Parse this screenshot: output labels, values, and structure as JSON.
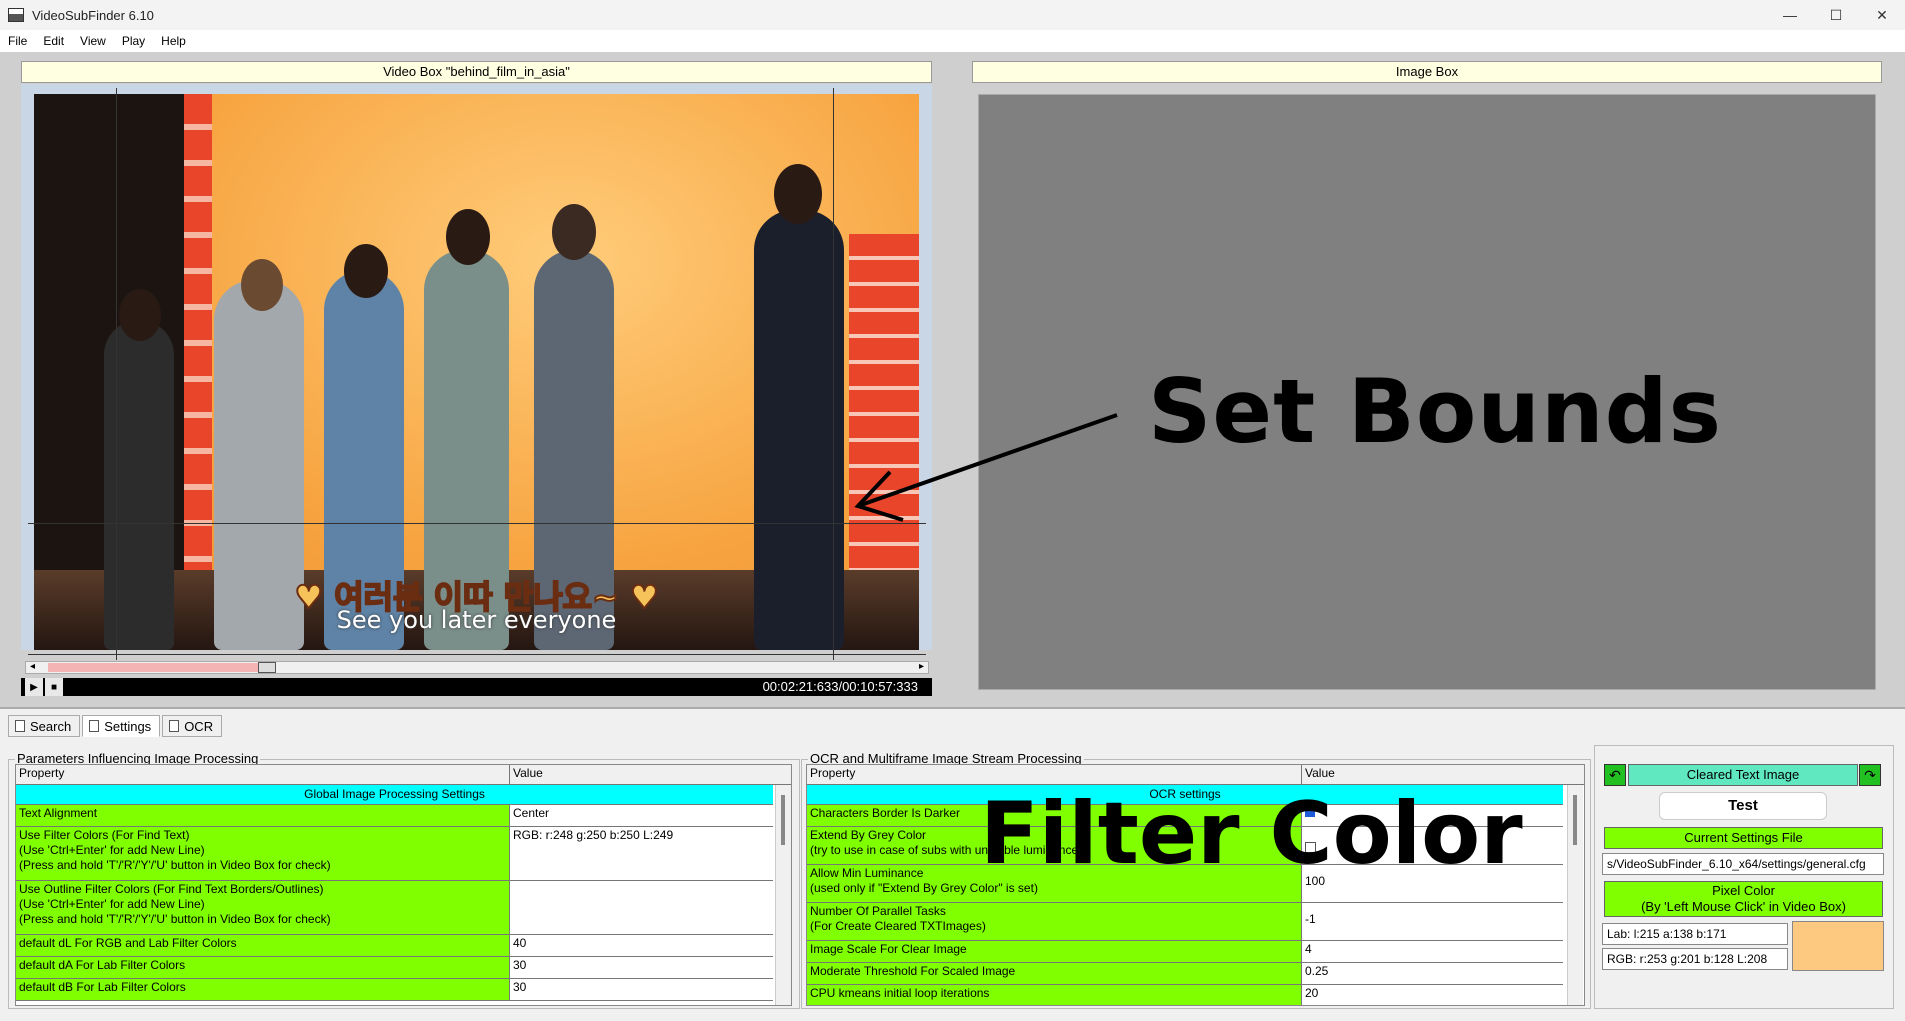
{
  "window": {
    "title": "VideoSubFinder 6.10",
    "controls": [
      "—",
      "☐",
      "✕"
    ]
  },
  "menu": [
    "File",
    "Edit",
    "View",
    "Play",
    "Help"
  ],
  "video_box": {
    "title": "Video Box \"behind_film_in_asia\"",
    "subtitle_korean": "♥ 여러분 이따 만나요~ ♥",
    "subtitle_english": "See you later everyone",
    "time": "00:02:21:633/00:10:57:333"
  },
  "image_box": {
    "title": "Image Box"
  },
  "annotations": {
    "set_bounds": "Set Bounds",
    "filter_color": "Filter Color"
  },
  "tabs": [
    "Search",
    "Settings",
    "OCR"
  ],
  "left_group": {
    "title": "Parameters Influencing Image Processing",
    "header": {
      "property": "Property",
      "value": "Value"
    },
    "section": "Global Image Processing Settings",
    "rows": [
      {
        "property": "Text Alignment",
        "value": "Center"
      },
      {
        "property": "Use Filter Colors (For Find Text)\n(Use 'Ctrl+Enter' for add New Line)\n(Press and hold 'T'/'R'/'Y'/'U' button in Video Box for check)",
        "value": "RGB: r:248 g:250 b:250 L:249"
      },
      {
        "property": "Use Outline Filter Colors (For Find Text Borders/Outlines)\n(Use 'Ctrl+Enter' for add New Line)\n(Press and hold 'T'/'R'/'Y'/'U' button in Video Box for check)",
        "value": ""
      },
      {
        "property": "default dL For RGB and Lab Filter Colors",
        "value": "40"
      },
      {
        "property": "default dA For Lab Filter Colors",
        "value": "30"
      },
      {
        "property": "default dB For Lab Filter Colors",
        "value": "30"
      }
    ]
  },
  "right_group": {
    "title": "OCR and Multiframe Image Stream Processing",
    "header": {
      "property": "Property",
      "value": "Value"
    },
    "section": "OCR settings",
    "rows": [
      {
        "property": "Characters Border Is Darker",
        "value": ""
      },
      {
        "property": "Extend By Grey Color\n(try to use in case of subs with unstable luminance)",
        "value": ""
      },
      {
        "property": "Allow Min Luminance\n(used only if \"Extend By Grey Color\" is set)",
        "value": "100"
      },
      {
        "property": "Number Of Parallel Tasks\n(For Create Cleared TXTImages)",
        "value": "-1"
      },
      {
        "property": "Image Scale For Clear Image",
        "value": "4"
      },
      {
        "property": "Moderate Threshold For Scaled Image",
        "value": "0.25"
      },
      {
        "property": "CPU kmeans initial loop iterations",
        "value": "20"
      }
    ]
  },
  "side": {
    "cleared_text_image": "Cleared Text Image",
    "test": "Test",
    "current_settings_file": "Current Settings File",
    "settings_path": "s/VideoSubFinder_6.10_x64/settings/general.cfg",
    "pixel_color": "Pixel Color\n(By 'Left Mouse Click' in Video Box)",
    "lab": "Lab: l:215 a:138 b:171",
    "rgb": "RGB: r:253 g:201 b:128 L:208",
    "swatch_color": "#fdc980"
  }
}
